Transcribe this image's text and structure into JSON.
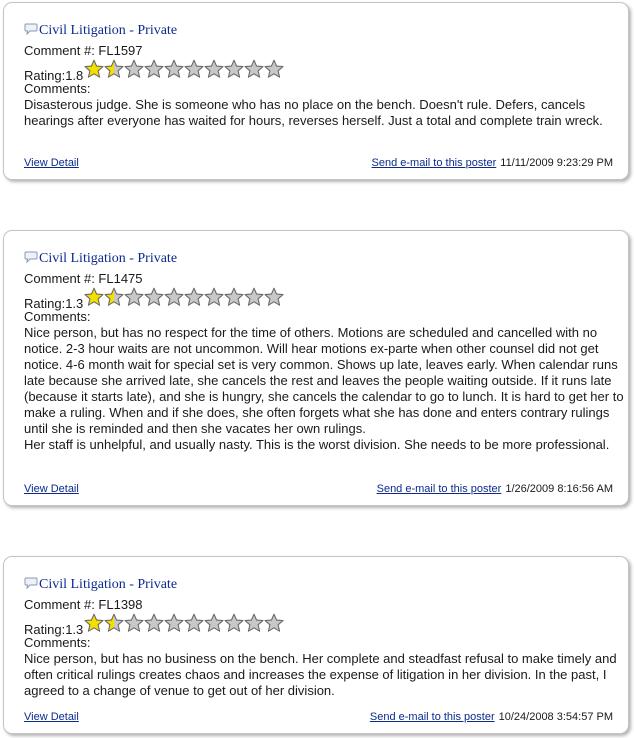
{
  "reviews": [
    {
      "category": "Civil Litigation - Private",
      "comment_number": "Comment #: FL1597",
      "rating_label": "Rating:1.8",
      "rating_value": 1.8,
      "stars_max": 10,
      "comments_label": "Comments:",
      "comment_text": "Disasterous judge. She is someone who has no place on the bench. Doesn't rule. Defers, cancels hearings after everyone has waited for hours, reverses herself. Just a total and complete train wreck.",
      "view_detail_label": "View Detail",
      "send_email_label": "Send e-mail to this poster",
      "date": "11/11/2009 9:23:29 PM"
    },
    {
      "category": "Civil Litigation - Private",
      "comment_number": "Comment #: FL1475",
      "rating_label": "Rating:1.3",
      "rating_value": 1.3,
      "stars_max": 10,
      "comments_label": "Comments:",
      "comment_text": "Nice person, but has no respect for the time of others. Motions are scheduled and cancelled with no notice. 2-3 hour waits are not uncommon. Will hear motions ex-parte when other counsel did not get notice. 4-6 month wait for special set is very common. Shows up late, leaves early. When calendar runs late because she arrived late, she cancels the rest and leaves the people waiting outside. If it runs late (because it starts late), and she is hungry, she cancels the calendar to go to lunch. It is hard to get her to make a ruling. When and if she does, she often forgets what she has done and enters contrary rulings until she is reminded and then she vacates her own rulings.\nHer staff is unhelpful, and usually nasty. This is the worst division. She needs to be more professional.",
      "view_detail_label": "View Detail",
      "send_email_label": "Send e-mail to this poster",
      "date": "1/26/2009 8:16:56 AM"
    },
    {
      "category": "Civil Litigation - Private",
      "comment_number": "Comment #: FL1398",
      "rating_label": "Rating:1.3",
      "rating_value": 1.3,
      "stars_max": 10,
      "comments_label": "Comments:",
      "comment_text": "Nice person, but has no business on the bench. Her complete and steadfast refusal to make timely and often critical rulings creates chaos and increases the expense of litigation in her division. In the past, I agreed to a change of venue to get out of her division.",
      "view_detail_label": "View Detail",
      "send_email_label": "Send e-mail to this poster",
      "date": "10/24/2008 3:54:57 PM"
    }
  ],
  "colors": {
    "link": "#0b2a8c",
    "star_filled": "#f4e000",
    "star_empty": "#c8c8c8",
    "star_outline": "#6a6a6a"
  }
}
